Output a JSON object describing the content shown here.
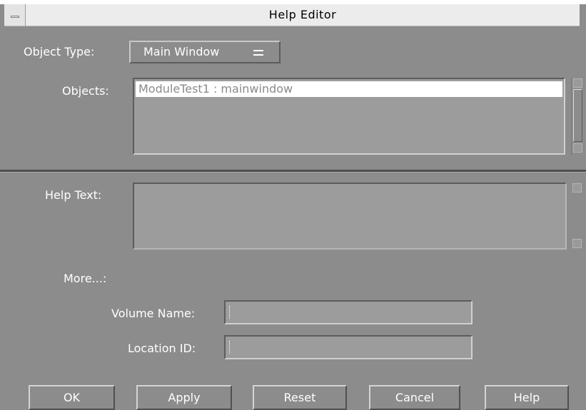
{
  "window": {
    "title": "Help Editor"
  },
  "object_type": {
    "label": "Object Type:",
    "selected": "Main Window"
  },
  "objects": {
    "label": "Objects:",
    "items": [
      "ModuleTest1 : mainwindow"
    ]
  },
  "help_text": {
    "label": "Help Text:",
    "value": ""
  },
  "more": {
    "label": "More...:"
  },
  "volume_name": {
    "label": "Volume Name:",
    "value": ""
  },
  "location_id": {
    "label": "Location ID:",
    "value": ""
  },
  "buttons": {
    "ok": "OK",
    "apply": "Apply",
    "reset": "Reset",
    "cancel": "Cancel",
    "help": "Help"
  },
  "colors": {
    "background": "#8c8c8c",
    "titlebar": "#ececec",
    "selection": "#ffffff"
  }
}
